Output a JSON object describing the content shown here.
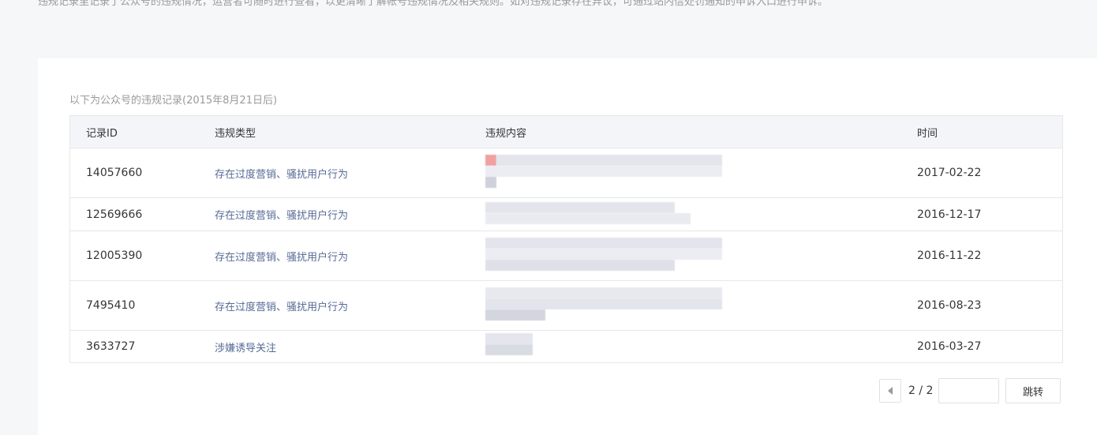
{
  "intro": {
    "text": "违规记录里记录了公众号的违规情况，运营者可随时进行查看，以更清晰了解帐号违规情况及相关规则。如对违规记录存在异议，可通过站内信处罚通知的申诉入口进行申诉。"
  },
  "records": {
    "caption": "以下为公众号的违规记录(2015年8月21日后)",
    "columns": {
      "id": "记录ID",
      "type": "违规类型",
      "content": "违规内容",
      "time": "时间"
    },
    "rows": [
      {
        "id": "14057660",
        "type": "存在过度营销、骚扰用户行为",
        "time": "2017-02-22"
      },
      {
        "id": "12569666",
        "type": "存在过度营销、骚扰用户行为",
        "time": "2016-12-17"
      },
      {
        "id": "12005390",
        "type": "存在过度营销、骚扰用户行为",
        "time": "2016-11-22"
      },
      {
        "id": "7495410",
        "type": "存在过度营销、骚扰用户行为",
        "time": "2016-08-23"
      },
      {
        "id": "3633727",
        "type": "涉嫌诱导关注",
        "time": "2016-03-27"
      }
    ]
  },
  "pager": {
    "page_text": "2 / 2",
    "jump_label": "跳转",
    "input_value": "",
    "prev_icon": "triangle-left-icon"
  },
  "colors": {
    "link": "#576b95",
    "background": "#f6f7f9",
    "header_bg": "#f4f5f9",
    "border": "#e7e7eb"
  }
}
